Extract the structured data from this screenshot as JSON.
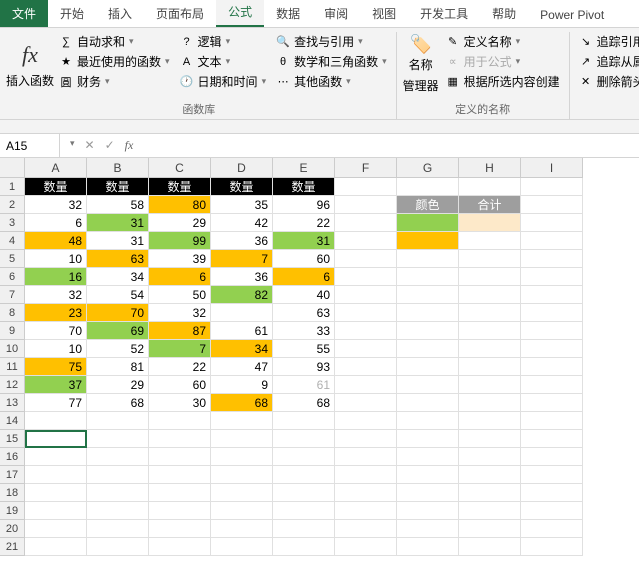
{
  "tabs": [
    "文件",
    "开始",
    "插入",
    "页面布局",
    "公式",
    "数据",
    "审阅",
    "视图",
    "开发工具",
    "帮助",
    "Power Pivot"
  ],
  "active_tab": 4,
  "ribbon": {
    "insert_fn": "插入函数",
    "fx": "fx",
    "autosum": "自动求和",
    "recent": "最近使用的函数",
    "financial": "财务",
    "logic": "逻辑",
    "text": "文本",
    "datetime": "日期和时间",
    "lookup": "查找与引用",
    "math": "数学和三角函数",
    "other": "其他函数",
    "lib_label": "函数库",
    "name_mgr": "名称",
    "name_mgr2": "管理器",
    "def_name": "定义名称",
    "use_formula": "用于公式",
    "create_sel": "根据所选内容创建",
    "names_label": "定义的名称",
    "trace_prec": "追踪引用",
    "trace_dep": "追踪从属",
    "remove_arr": "删除箭头"
  },
  "namebox": "A15",
  "formula": "",
  "columns": [
    "A",
    "B",
    "C",
    "D",
    "E",
    "F",
    "G",
    "H",
    "I"
  ],
  "rows": 21,
  "selected": {
    "row": 15,
    "col": 0
  },
  "headers_row1": [
    "数量",
    "数量",
    "数量",
    "数量",
    "数量"
  ],
  "headers_gh": {
    "G": "颜色",
    "H": "合计"
  },
  "cells": [
    {
      "r": 2,
      "c": 0,
      "v": "32"
    },
    {
      "r": 2,
      "c": 1,
      "v": "58"
    },
    {
      "r": 2,
      "c": 2,
      "v": "80",
      "cls": "orange"
    },
    {
      "r": 2,
      "c": 3,
      "v": "35"
    },
    {
      "r": 2,
      "c": 4,
      "v": "96"
    },
    {
      "r": 3,
      "c": 0,
      "v": "6"
    },
    {
      "r": 3,
      "c": 1,
      "v": "31",
      "cls": "green"
    },
    {
      "r": 3,
      "c": 2,
      "v": "29"
    },
    {
      "r": 3,
      "c": 3,
      "v": "42"
    },
    {
      "r": 3,
      "c": 4,
      "v": "22"
    },
    {
      "r": 3,
      "c": 6,
      "cls": "green"
    },
    {
      "r": 3,
      "c": 7,
      "cls": "cream"
    },
    {
      "r": 4,
      "c": 0,
      "v": "48",
      "cls": "orange"
    },
    {
      "r": 4,
      "c": 1,
      "v": "31"
    },
    {
      "r": 4,
      "c": 2,
      "v": "99",
      "cls": "green"
    },
    {
      "r": 4,
      "c": 3,
      "v": "36"
    },
    {
      "r": 4,
      "c": 4,
      "v": "31",
      "cls": "green"
    },
    {
      "r": 4,
      "c": 6,
      "cls": "orange"
    },
    {
      "r": 5,
      "c": 0,
      "v": "10"
    },
    {
      "r": 5,
      "c": 1,
      "v": "63",
      "cls": "orange"
    },
    {
      "r": 5,
      "c": 2,
      "v": "39"
    },
    {
      "r": 5,
      "c": 3,
      "v": "7",
      "cls": "orange"
    },
    {
      "r": 5,
      "c": 4,
      "v": "60"
    },
    {
      "r": 6,
      "c": 0,
      "v": "16",
      "cls": "green"
    },
    {
      "r": 6,
      "c": 1,
      "v": "34"
    },
    {
      "r": 6,
      "c": 2,
      "v": "6",
      "cls": "orange"
    },
    {
      "r": 6,
      "c": 3,
      "v": "36"
    },
    {
      "r": 6,
      "c": 4,
      "v": "6",
      "cls": "orange"
    },
    {
      "r": 7,
      "c": 0,
      "v": "32"
    },
    {
      "r": 7,
      "c": 1,
      "v": "54"
    },
    {
      "r": 7,
      "c": 2,
      "v": "50"
    },
    {
      "r": 7,
      "c": 3,
      "v": "82",
      "cls": "green"
    },
    {
      "r": 7,
      "c": 4,
      "v": "40"
    },
    {
      "r": 8,
      "c": 0,
      "v": "23",
      "cls": "orange"
    },
    {
      "r": 8,
      "c": 1,
      "v": "70",
      "cls": "orange"
    },
    {
      "r": 8,
      "c": 2,
      "v": "32"
    },
    {
      "r": 8,
      "c": 4,
      "v": "63"
    },
    {
      "r": 9,
      "c": 0,
      "v": "70"
    },
    {
      "r": 9,
      "c": 1,
      "v": "69",
      "cls": "green"
    },
    {
      "r": 9,
      "c": 2,
      "v": "87",
      "cls": "orange"
    },
    {
      "r": 9,
      "c": 3,
      "v": "61"
    },
    {
      "r": 9,
      "c": 4,
      "v": "33"
    },
    {
      "r": 10,
      "c": 0,
      "v": "10"
    },
    {
      "r": 10,
      "c": 1,
      "v": "52"
    },
    {
      "r": 10,
      "c": 2,
      "v": "7",
      "cls": "green"
    },
    {
      "r": 10,
      "c": 3,
      "v": "34",
      "cls": "orange"
    },
    {
      "r": 10,
      "c": 4,
      "v": "55"
    },
    {
      "r": 11,
      "c": 0,
      "v": "75",
      "cls": "orange"
    },
    {
      "r": 11,
      "c": 1,
      "v": "81"
    },
    {
      "r": 11,
      "c": 2,
      "v": "22"
    },
    {
      "r": 11,
      "c": 3,
      "v": "47"
    },
    {
      "r": 11,
      "c": 4,
      "v": "93"
    },
    {
      "r": 12,
      "c": 0,
      "v": "37",
      "cls": "green"
    },
    {
      "r": 12,
      "c": 1,
      "v": "29"
    },
    {
      "r": 12,
      "c": 2,
      "v": "60"
    },
    {
      "r": 12,
      "c": 3,
      "v": "9"
    },
    {
      "r": 12,
      "c": 4,
      "v": "61",
      "light": true
    },
    {
      "r": 13,
      "c": 0,
      "v": "77"
    },
    {
      "r": 13,
      "c": 1,
      "v": "68"
    },
    {
      "r": 13,
      "c": 2,
      "v": "30"
    },
    {
      "r": 13,
      "c": 3,
      "v": "68",
      "cls": "orange"
    },
    {
      "r": 13,
      "c": 4,
      "v": "68"
    }
  ]
}
